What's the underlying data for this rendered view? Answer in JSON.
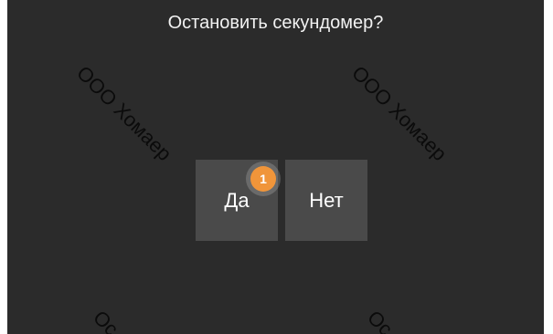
{
  "dialog": {
    "title": "Остановить секундомер?",
    "buttons": {
      "yes": "Да",
      "no": "Нет"
    }
  },
  "watermark": {
    "text": "ООО Хомаер",
    "partial": "Ос"
  },
  "annotation": {
    "marker_label": "1",
    "marker_color": "#f0953a"
  },
  "colors": {
    "background": "#2b2b2b",
    "button": "#4a4a4a",
    "text": "#f2f2f2"
  }
}
